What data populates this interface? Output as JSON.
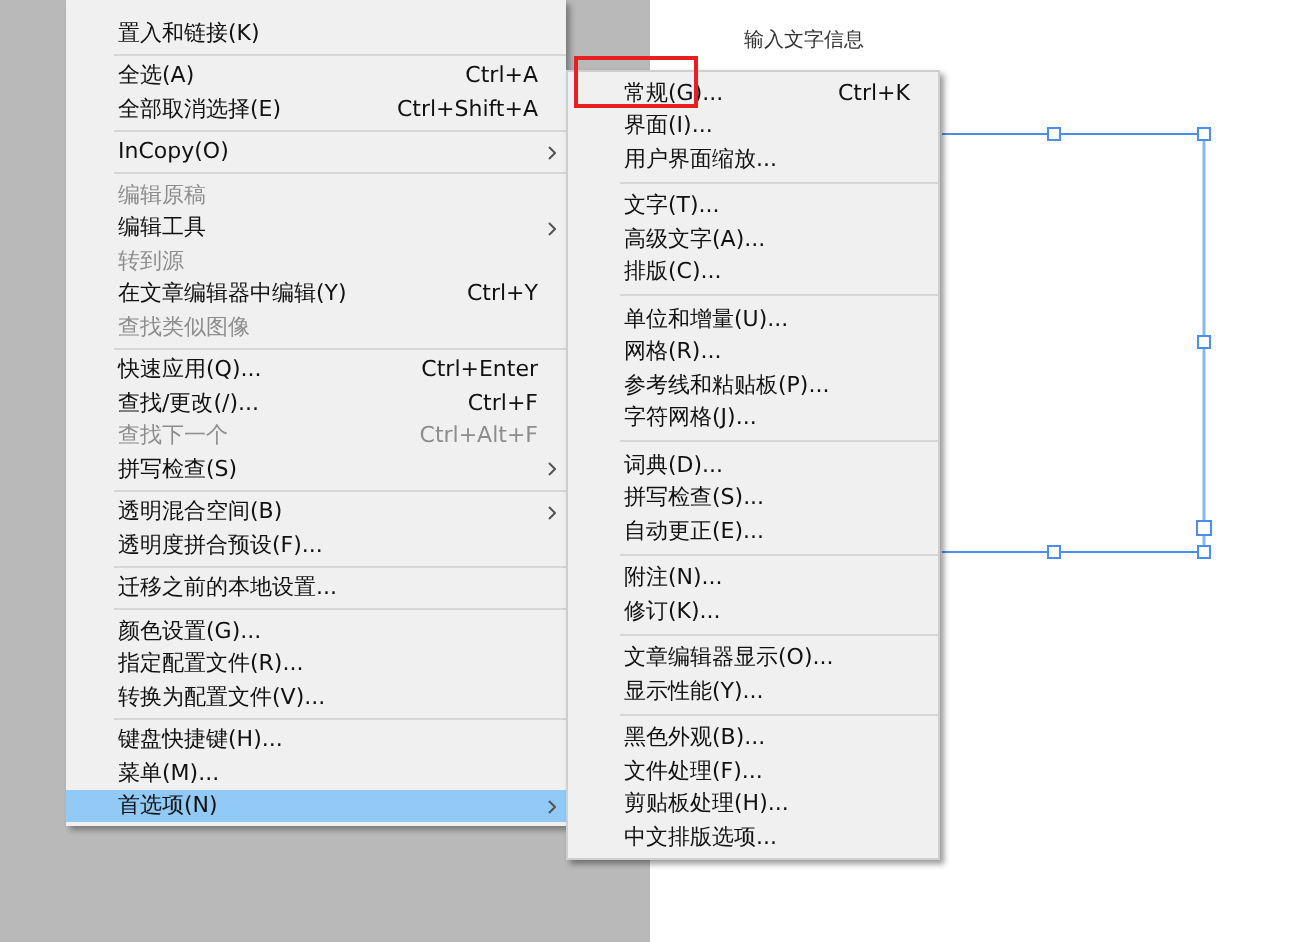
{
  "main_menu": {
    "items": [
      {
        "kind": "item",
        "label": "置入和链接(K)",
        "disabled": false,
        "submenu": false,
        "selected": false
      },
      {
        "kind": "separator"
      },
      {
        "kind": "item",
        "label": "全选(A)",
        "shortcut": "Ctrl+A",
        "disabled": false,
        "submenu": false,
        "selected": false
      },
      {
        "kind": "item",
        "label": "全部取消选择(E)",
        "shortcut": "Ctrl+Shift+A",
        "disabled": false,
        "submenu": false,
        "selected": false
      },
      {
        "kind": "separator"
      },
      {
        "kind": "item",
        "label": "InCopy(O)",
        "disabled": false,
        "submenu": true,
        "selected": false
      },
      {
        "kind": "separator"
      },
      {
        "kind": "item",
        "label": "编辑原稿",
        "disabled": true,
        "submenu": false,
        "selected": false
      },
      {
        "kind": "item",
        "label": "编辑工具",
        "disabled": false,
        "submenu": true,
        "selected": false
      },
      {
        "kind": "item",
        "label": "转到源",
        "disabled": true,
        "submenu": false,
        "selected": false
      },
      {
        "kind": "item",
        "label": "在文章编辑器中编辑(Y)",
        "shortcut": "Ctrl+Y",
        "disabled": false,
        "submenu": false,
        "selected": false
      },
      {
        "kind": "item",
        "label": "查找类似图像",
        "disabled": true,
        "submenu": false,
        "selected": false
      },
      {
        "kind": "separator"
      },
      {
        "kind": "item",
        "label": "快速应用(Q)...",
        "shortcut": "Ctrl+Enter",
        "disabled": false,
        "submenu": false,
        "selected": false
      },
      {
        "kind": "item",
        "label": "查找/更改(/)...",
        "shortcut": "Ctrl+F",
        "disabled": false,
        "submenu": false,
        "selected": false
      },
      {
        "kind": "item",
        "label": "查找下一个",
        "shortcut": "Ctrl+Alt+F",
        "disabled": true,
        "submenu": false,
        "selected": false
      },
      {
        "kind": "item",
        "label": "拼写检查(S)",
        "disabled": false,
        "submenu": true,
        "selected": false
      },
      {
        "kind": "separator"
      },
      {
        "kind": "item",
        "label": "透明混合空间(B)",
        "disabled": false,
        "submenu": true,
        "selected": false
      },
      {
        "kind": "item",
        "label": "透明度拼合预设(F)...",
        "disabled": false,
        "submenu": false,
        "selected": false
      },
      {
        "kind": "separator"
      },
      {
        "kind": "item",
        "label": "迁移之前的本地设置...",
        "disabled": false,
        "submenu": false,
        "selected": false
      },
      {
        "kind": "separator"
      },
      {
        "kind": "item",
        "label": "颜色设置(G)...",
        "disabled": false,
        "submenu": false,
        "selected": false
      },
      {
        "kind": "item",
        "label": "指定配置文件(R)...",
        "disabled": false,
        "submenu": false,
        "selected": false
      },
      {
        "kind": "item",
        "label": "转换为配置文件(V)...",
        "disabled": false,
        "submenu": false,
        "selected": false
      },
      {
        "kind": "separator"
      },
      {
        "kind": "item",
        "label": "键盘快捷键(H)...",
        "disabled": false,
        "submenu": false,
        "selected": false
      },
      {
        "kind": "item",
        "label": "菜单(M)...",
        "disabled": false,
        "submenu": false,
        "selected": false
      },
      {
        "kind": "item",
        "label": "首选项(N)",
        "disabled": false,
        "submenu": true,
        "selected": true
      }
    ]
  },
  "submenu": {
    "items": [
      {
        "kind": "item",
        "label": "常规(G)...",
        "shortcut": "Ctrl+K"
      },
      {
        "kind": "item",
        "label": "界面(I)..."
      },
      {
        "kind": "item",
        "label": "用户界面缩放..."
      },
      {
        "kind": "separator"
      },
      {
        "kind": "item",
        "label": "文字(T)..."
      },
      {
        "kind": "item",
        "label": "高级文字(A)..."
      },
      {
        "kind": "item",
        "label": "排版(C)..."
      },
      {
        "kind": "separator"
      },
      {
        "kind": "item",
        "label": "单位和增量(U)..."
      },
      {
        "kind": "item",
        "label": "网格(R)..."
      },
      {
        "kind": "item",
        "label": "参考线和粘贴板(P)..."
      },
      {
        "kind": "item",
        "label": "字符网格(J)..."
      },
      {
        "kind": "separator"
      },
      {
        "kind": "item",
        "label": "词典(D)..."
      },
      {
        "kind": "item",
        "label": "拼写检查(S)..."
      },
      {
        "kind": "item",
        "label": "自动更正(E)..."
      },
      {
        "kind": "separator"
      },
      {
        "kind": "item",
        "label": "附注(N)..."
      },
      {
        "kind": "item",
        "label": "修订(K)..."
      },
      {
        "kind": "separator"
      },
      {
        "kind": "item",
        "label": "文章编辑器显示(O)..."
      },
      {
        "kind": "item",
        "label": "显示性能(Y)..."
      },
      {
        "kind": "separator"
      },
      {
        "kind": "item",
        "label": "黑色外观(B)..."
      },
      {
        "kind": "item",
        "label": "文件处理(F)..."
      },
      {
        "kind": "item",
        "label": "剪贴板处理(H)..."
      },
      {
        "kind": "item",
        "label": "中文排版选项..."
      }
    ]
  },
  "canvas": {
    "text": "输入文字信息"
  }
}
